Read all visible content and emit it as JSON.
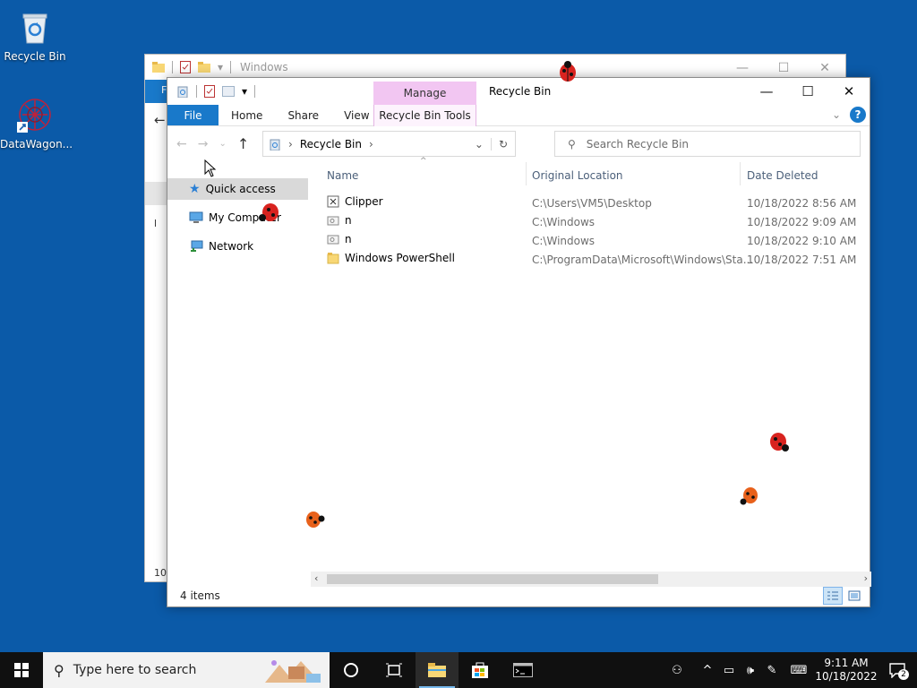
{
  "desktop": {
    "icons": [
      {
        "label": "Recycle Bin",
        "icon": "recycle-bin-icon"
      },
      {
        "label": "DataWagon...",
        "icon": "datawagon-shortcut-icon"
      }
    ]
  },
  "background_window": {
    "title": "Windows",
    "controls": [
      "minimize",
      "maximize",
      "close"
    ],
    "strip_letter": "F",
    "side_text_1": "l",
    "side_text_2": "10"
  },
  "window": {
    "title": "Recycle Bin",
    "contextual_tab_group": "Manage",
    "ribbon_tabs": [
      "File",
      "Home",
      "Share",
      "View",
      "Recycle Bin Tools"
    ],
    "address": {
      "location": "Recycle Bin"
    },
    "search": {
      "placeholder": "Search Recycle Bin"
    },
    "nav_pane": [
      {
        "label": "Quick access",
        "icon": "star-icon",
        "selected": true
      },
      {
        "label": "My Computer",
        "icon": "computer-icon"
      },
      {
        "label": "Network",
        "icon": "network-icon"
      }
    ],
    "columns": [
      "Name",
      "Original Location",
      "Date Deleted"
    ],
    "files": [
      {
        "name": "Clipper",
        "location": "C:\\Users\\VM5\\Desktop",
        "deleted": "10/18/2022 8:56 AM",
        "icon": "app-icon"
      },
      {
        "name": "n",
        "location": "C:\\Windows",
        "deleted": "10/18/2022 9:09 AM",
        "icon": "file-icon"
      },
      {
        "name": "n",
        "location": "C:\\Windows",
        "deleted": "10/18/2022 9:10 AM",
        "icon": "file-icon"
      },
      {
        "name": "Windows PowerShell",
        "location": "C:\\ProgramData\\Microsoft\\Windows\\Sta...",
        "deleted": "10/18/2022 7:51 AM",
        "icon": "folder-icon"
      }
    ],
    "status": "4 items"
  },
  "taskbar": {
    "search_placeholder": "Type here to search",
    "time": "9:11 AM",
    "date": "10/18/2022",
    "notification_count": "2"
  },
  "colors": {
    "desktop": "#0b5aa8",
    "accent": "#1979ca",
    "manage_tab": "#f2c6f2",
    "taskbar": "#101010"
  }
}
